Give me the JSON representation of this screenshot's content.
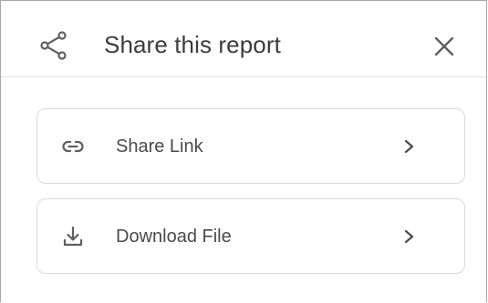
{
  "header": {
    "title": "Share this report",
    "share_icon": "share-icon",
    "close_icon": "close-icon"
  },
  "options": [
    {
      "label": "Share Link",
      "icon": "link-icon"
    },
    {
      "label": "Download File",
      "icon": "download-icon"
    }
  ],
  "colors": {
    "text": "#3c3c3c",
    "icon": "#5f5f5f",
    "border": "#dadada"
  }
}
